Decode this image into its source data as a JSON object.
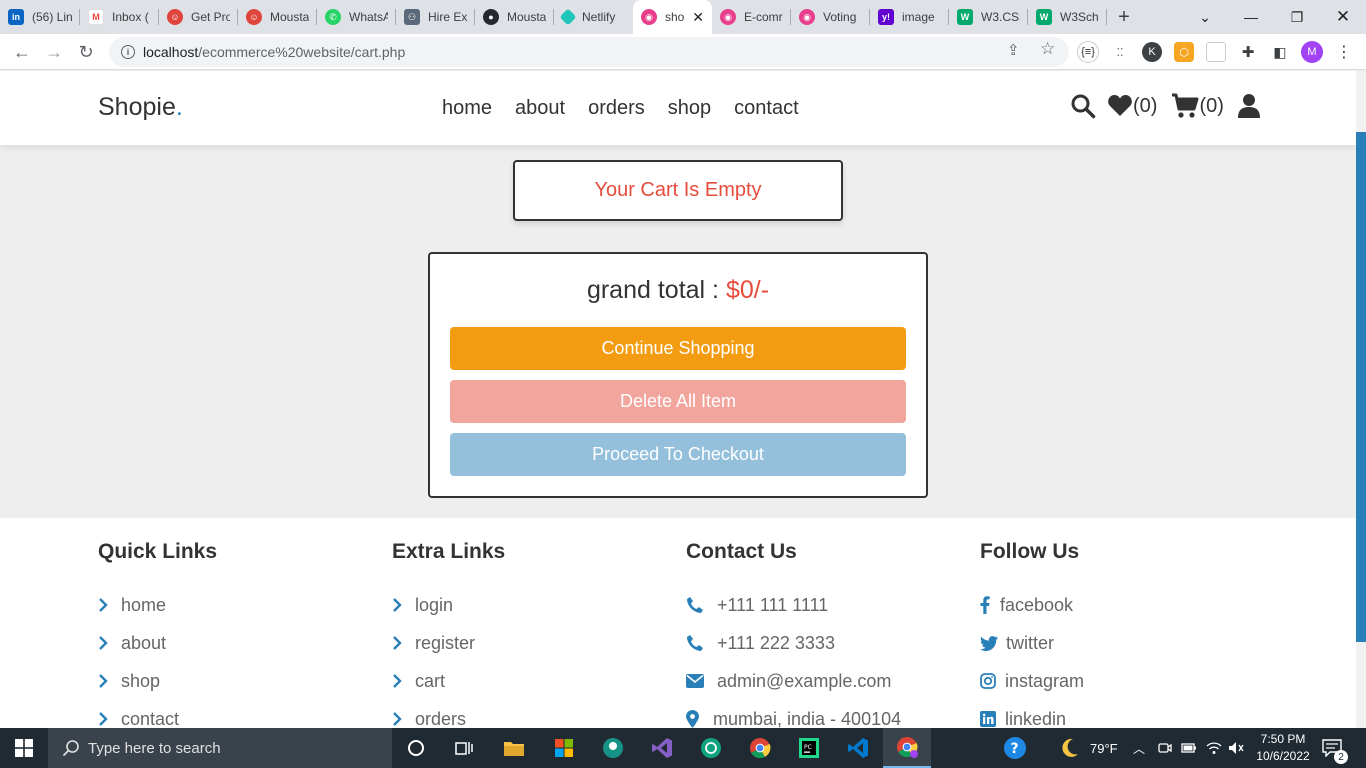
{
  "browser": {
    "tabs": [
      {
        "label": "(56) Lin",
        "icon": "linkedin-icon",
        "color": "#0a66c2"
      },
      {
        "label": "Inbox (",
        "icon": "gmail-icon",
        "color": "#ea4335"
      },
      {
        "label": "Get Pro",
        "icon": "face-icon",
        "color": "#e0453b"
      },
      {
        "label": "Mousta",
        "icon": "face-icon",
        "color": "#e0453b"
      },
      {
        "label": "WhatsA",
        "icon": "whatsapp-icon",
        "color": "#25d366"
      },
      {
        "label": "Hire Ex",
        "icon": "people-icon",
        "color": "#5b6a7a"
      },
      {
        "label": "Mousta",
        "icon": "github-icon",
        "color": "#24292f"
      },
      {
        "label": "Netlify",
        "icon": "netlify-icon",
        "color": "#20c6b7"
      },
      {
        "label": "sho",
        "icon": "app-icon",
        "color": "#e83e8c",
        "active": true
      },
      {
        "label": "E-comr",
        "icon": "app-icon",
        "color": "#e83e8c"
      },
      {
        "label": "Voting",
        "icon": "app-icon",
        "color": "#e83e8c"
      },
      {
        "label": "image",
        "icon": "yahoo-icon",
        "color": "#6001d2"
      },
      {
        "label": "W3.CSS",
        "icon": "w3-icon",
        "color": "#04aa6d"
      },
      {
        "label": "W3Sch",
        "icon": "w3-icon",
        "color": "#04aa6d"
      }
    ],
    "url_host": "localhost",
    "url_path": "/ecommerce%20website/cart.php",
    "profile_initial": "M",
    "ext_k": "K"
  },
  "site": {
    "logo": "Shopie",
    "logo_dot": ".",
    "nav": [
      "home",
      "about",
      "orders",
      "shop",
      "contact"
    ],
    "wishlist_count": "(0)",
    "cart_count": "(0)"
  },
  "cart": {
    "empty_message": "Your Cart Is Empty",
    "grand_total_label": "grand total : ",
    "grand_total_value": "$0/-",
    "continue_label": "Continue Shopping",
    "delete_label": "Delete All Item",
    "checkout_label": "Proceed To Checkout"
  },
  "footer": {
    "quick": {
      "title": "Quick Links",
      "items": [
        "home",
        "about",
        "shop",
        "contact"
      ]
    },
    "extra": {
      "title": "Extra Links",
      "items": [
        "login",
        "register",
        "cart",
        "orders"
      ]
    },
    "contact": {
      "title": "Contact Us",
      "items": [
        "+111 111 1111",
        "+111 222 3333",
        "admin@example.com",
        "mumbai, india - 400104"
      ]
    },
    "follow": {
      "title": "Follow Us",
      "items": [
        "facebook",
        "twitter",
        "instagram",
        "linkedin"
      ]
    }
  },
  "taskbar": {
    "search_placeholder": "Type here to search",
    "weather": "79°F",
    "time": "7:50 PM",
    "date": "10/6/2022",
    "notifications": "2"
  },
  "colors": {
    "accent": "#2980b9",
    "red": "#e74c3c",
    "orange": "#f39c12"
  }
}
